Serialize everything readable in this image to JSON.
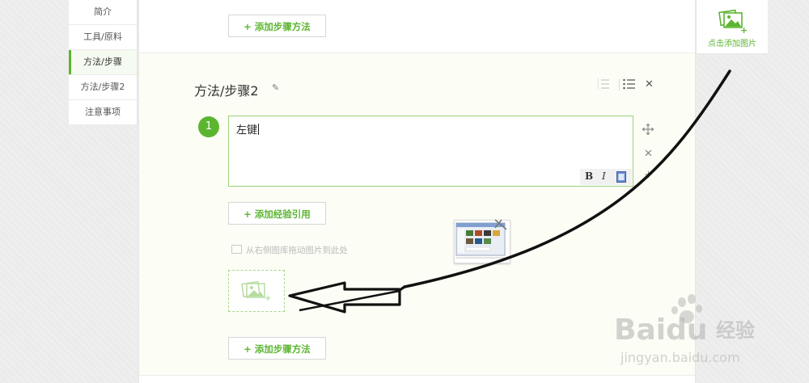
{
  "left_nav": {
    "items": [
      {
        "label": "简介",
        "active": false
      },
      {
        "label": "工具/原料",
        "active": false
      },
      {
        "label": "方法/步骤",
        "active": true
      },
      {
        "label": "方法/步骤2",
        "active": false
      },
      {
        "label": "注意事项",
        "active": false
      }
    ]
  },
  "main": {
    "add_method_top": "+ 添加步骤方法",
    "section": {
      "title": "方法/步骤2",
      "step_number": "1",
      "step_text": "左键",
      "format_buttons": {
        "bold": "B",
        "italic": "I"
      },
      "add_reference": "+ 添加经验引用",
      "drag_hint": "从右侧图库拖动图片到此处"
    },
    "add_method_bottom": "+ 添加步骤方法"
  },
  "right_panel": {
    "add_image_label": "点击添加图片"
  },
  "watermark": {
    "brand": "Baidu",
    "brand_cn": "经验",
    "url": "jingyan.baidu.com"
  },
  "colors": {
    "accent": "#5cb531",
    "section_bg": "#fcfdf5",
    "drop_border": "#a6d68a"
  },
  "icons": [
    "pencil-icon",
    "ordered-list-icon",
    "unordered-list-icon",
    "close-icon",
    "move-icon",
    "image-add-icon",
    "image-icon"
  ]
}
